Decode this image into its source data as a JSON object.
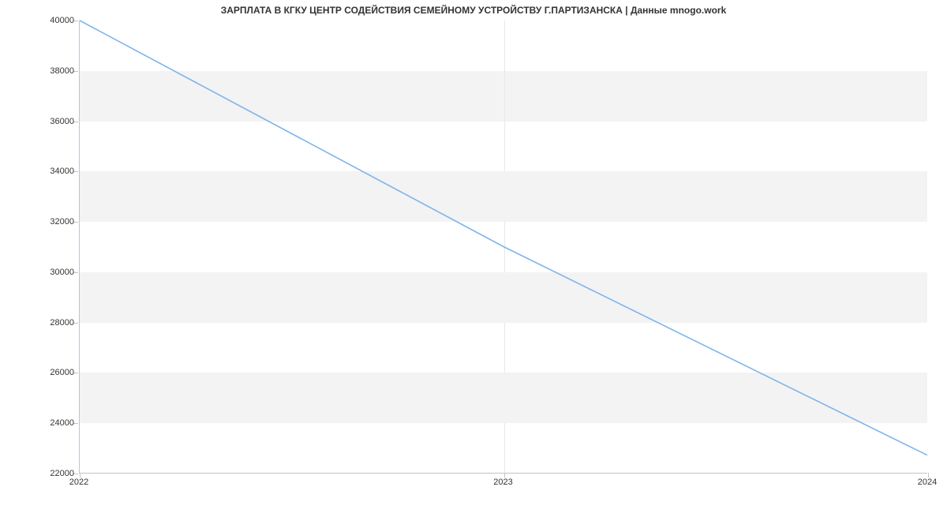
{
  "chart_data": {
    "type": "line",
    "title": "ЗАРПЛАТА В КГКУ ЦЕНТР СОДЕЙСТВИЯ СЕМЕЙНОМУ УСТРОЙСТВУ Г.ПАРТИЗАНСКА | Данные mnogo.work",
    "xlabel": "",
    "ylabel": "",
    "x": [
      2022,
      2023,
      2024
    ],
    "values": [
      40000,
      31000,
      22700
    ],
    "xlim": [
      2022,
      2024
    ],
    "ylim": [
      22000,
      40000
    ],
    "y_ticks": [
      22000,
      24000,
      26000,
      28000,
      30000,
      32000,
      34000,
      36000,
      38000,
      40000
    ],
    "x_ticks": [
      2022,
      2023,
      2024
    ],
    "line_color": "#7cb5ec",
    "band_color": "#f3f3f3"
  }
}
